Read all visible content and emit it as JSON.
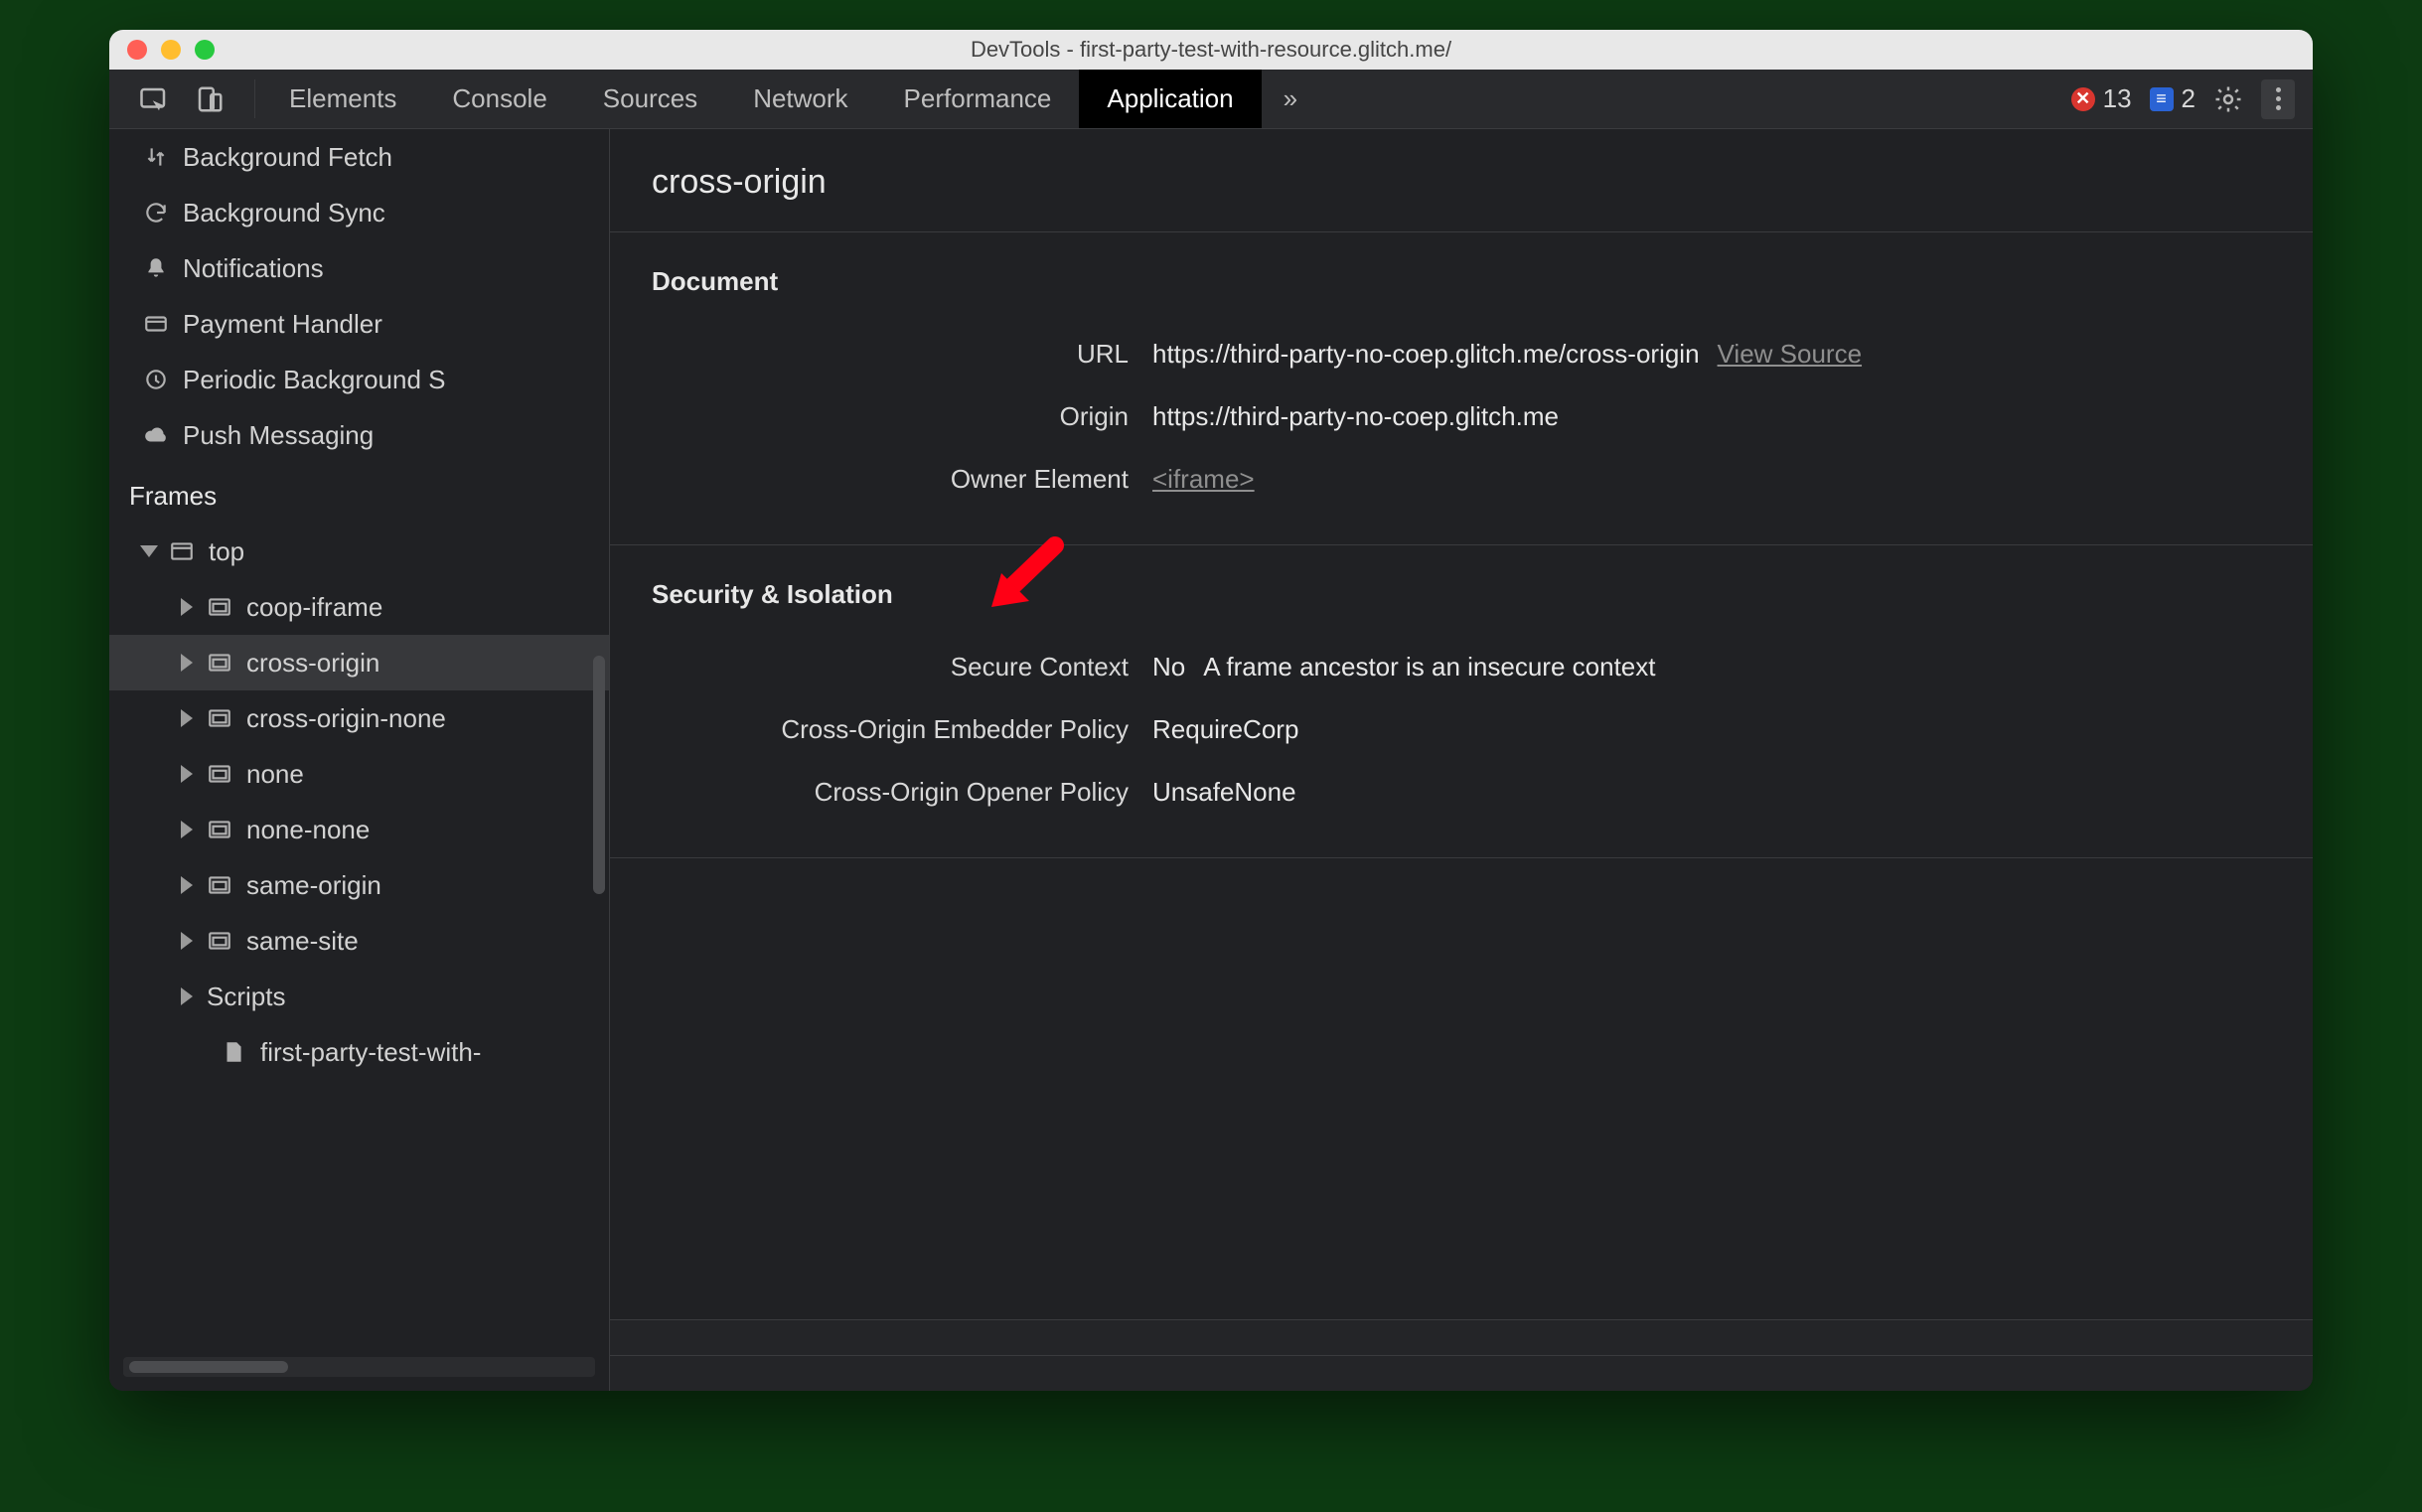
{
  "window": {
    "title": "DevTools - first-party-test-with-resource.glitch.me/",
    "traffic_colors": {
      "close": "#ff5f56",
      "minimize": "#ffbd2e",
      "zoom": "#27c93f"
    }
  },
  "tabs": {
    "items": [
      "Elements",
      "Console",
      "Sources",
      "Network",
      "Performance",
      "Application"
    ],
    "active": "Application",
    "overflow_glyph": "»"
  },
  "toolbar_right": {
    "error_count": "13",
    "info_count": "2"
  },
  "sidebar": {
    "background_services": [
      {
        "icon": "sync-vert",
        "label": "Background Fetch"
      },
      {
        "icon": "sync",
        "label": "Background Sync"
      },
      {
        "icon": "bell",
        "label": "Notifications"
      },
      {
        "icon": "card",
        "label": "Payment Handler"
      },
      {
        "icon": "clock",
        "label": "Periodic Background S"
      },
      {
        "icon": "cloud",
        "label": "Push Messaging"
      }
    ],
    "frames_header": "Frames",
    "top_label": "top",
    "frames": [
      "coop-iframe",
      "cross-origin",
      "cross-origin-none",
      "none",
      "none-none",
      "same-origin",
      "same-site"
    ],
    "selected_frame": "cross-origin",
    "scripts_label": "Scripts",
    "script_file": "first-party-test-with-"
  },
  "detail": {
    "title": "cross-origin",
    "document": {
      "heading": "Document",
      "url_label": "URL",
      "url_value": "https://third-party-no-coep.glitch.me/cross-origin",
      "view_source": "View Source",
      "origin_label": "Origin",
      "origin_value": "https://third-party-no-coep.glitch.me",
      "owner_label": "Owner Element",
      "owner_value": "<iframe>"
    },
    "security": {
      "heading": "Security & Isolation",
      "secure_label": "Secure Context",
      "secure_value": "No",
      "secure_note": "A frame ancestor is an insecure context",
      "coep_label": "Cross-Origin Embedder Policy",
      "coep_value": "RequireCorp",
      "coop_label": "Cross-Origin Opener Policy",
      "coop_value": "UnsafeNone"
    }
  },
  "annotation": {
    "color": "#ff0015"
  }
}
